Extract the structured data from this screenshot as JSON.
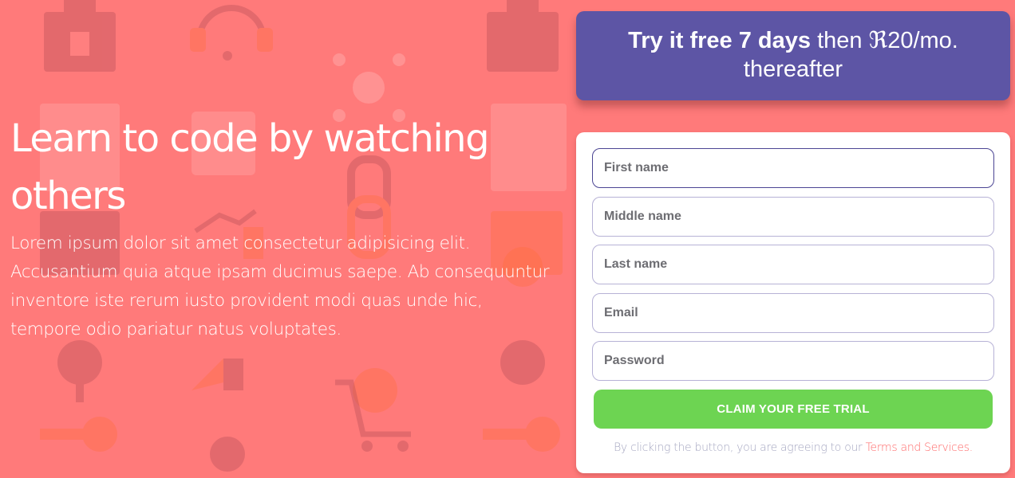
{
  "hero": {
    "headline": "Learn to code by watching others",
    "body": "Lorem ipsum dolor sit amet consectetur adipisicing elit. Accusantium quia atque ipsam ducimus saepe. Ab consequuntur inventore iste rerum iusto provident modi quas unde hic, tempore odio pariatur natus voluptates."
  },
  "offer": {
    "bold": "Try it free 7 days",
    "rest": " then ℜ20/mo. thereafter"
  },
  "form": {
    "fields": [
      {
        "placeholder": "First name"
      },
      {
        "placeholder": "Middle name"
      },
      {
        "placeholder": "Last name"
      },
      {
        "placeholder": "Email"
      },
      {
        "placeholder": "Password"
      }
    ],
    "submit_label": "CLAIM YOUR FREE TRIAL",
    "disclaimer_prefix": "By clicking the button, you are agreeing to our ",
    "terms_link": "Terms and Services."
  },
  "colors": {
    "background": "#ff7a7a",
    "offer_bg": "#5d55a5",
    "cta_bg": "#6dd452",
    "link": "#ff6b6b"
  },
  "background_icons": [
    "toolbox-icon",
    "headset-icon",
    "network-icon",
    "hierarchy-icon",
    "files-icon",
    "idea-icon",
    "chain-link-icon",
    "chart-icon",
    "gear-icon",
    "search-icon",
    "shopping-cart-icon",
    "key-icon",
    "globe-icon",
    "megaphone-icon"
  ]
}
